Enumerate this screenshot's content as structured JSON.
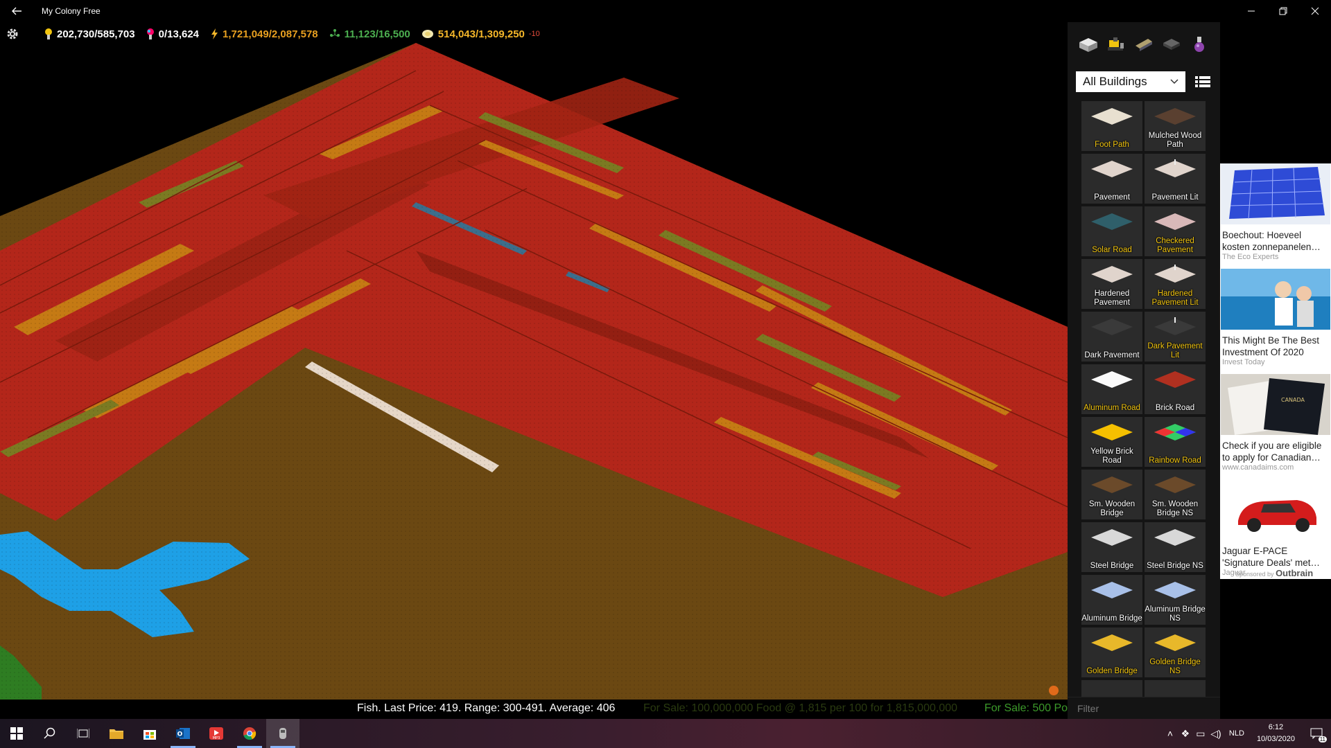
{
  "window": {
    "title": "My Colony Free"
  },
  "hud": {
    "gold": "202,730/585,703",
    "research": "0/13,624",
    "energy": "1,721,049/2,087,578",
    "population": "11,123/16,500",
    "food": "514,043/1,309,250",
    "food_delta": "-10"
  },
  "ticker": {
    "item1": "Fish. Last Price: 419. Range: 300-491. Average: 406",
    "item2": "For Sale: 100,000,000 Food @ 1,815 per 100 for 1,815,000,000",
    "item3": "For Sale: 500 Po"
  },
  "sidebar": {
    "tabs": [
      "buildings-tab",
      "vehicles-tab",
      "spaceship-tab",
      "tiles-tab",
      "potion-tab"
    ],
    "dropdown": "All Buildings",
    "filter_placeholder": "Filter",
    "tiles": [
      {
        "name": "Foot Path",
        "color": "yellow"
      },
      {
        "name": "Mulched Wood Path",
        "color": "white"
      },
      {
        "name": "Pavement",
        "color": "white"
      },
      {
        "name": "Pavement Lit",
        "color": "white"
      },
      {
        "name": "Solar Road",
        "color": "yellow"
      },
      {
        "name": "Checkered Pavement",
        "color": "yellow"
      },
      {
        "name": "Hardened Pavement",
        "color": "white"
      },
      {
        "name": "Hardened Pavement Lit",
        "color": "yellow"
      },
      {
        "name": "Dark Pavement",
        "color": "white"
      },
      {
        "name": "Dark Pavement Lit",
        "color": "yellow"
      },
      {
        "name": "Aluminum Road",
        "color": "yellow"
      },
      {
        "name": "Brick Road",
        "color": "white"
      },
      {
        "name": "Yellow Brick Road",
        "color": "white"
      },
      {
        "name": "Rainbow Road",
        "color": "yellow"
      },
      {
        "name": "Sm. Wooden Bridge",
        "color": "white"
      },
      {
        "name": "Sm. Wooden Bridge NS",
        "color": "white"
      },
      {
        "name": "Steel Bridge",
        "color": "white"
      },
      {
        "name": "Steel Bridge NS",
        "color": "white"
      },
      {
        "name": "Aluminum Bridge",
        "color": "white"
      },
      {
        "name": "Aluminum Bridge NS",
        "color": "white"
      },
      {
        "name": "Golden Bridge",
        "color": "yellow"
      },
      {
        "name": "Golden Bridge NS",
        "color": "yellow"
      }
    ]
  },
  "ads": [
    {
      "title": "Boechout: Hoeveel kosten zonnepanelen…",
      "source": "The Eco Experts"
    },
    {
      "title": "This Might Be The Best Investment Of 2020",
      "source": "Invest Today"
    },
    {
      "title": "Check if you are eligible to apply for Canadian…",
      "source": "www.canadaims.com"
    },
    {
      "title": "Jaguar E-PACE 'Signature Deals' met…",
      "source": "Jaguar"
    }
  ],
  "ads_sponsor": "Sponsored by",
  "ads_brand": "Outbrain",
  "taskbar": {
    "lang": "NLD",
    "time": "6:12",
    "date": "10/03/2020",
    "notif": "11"
  }
}
